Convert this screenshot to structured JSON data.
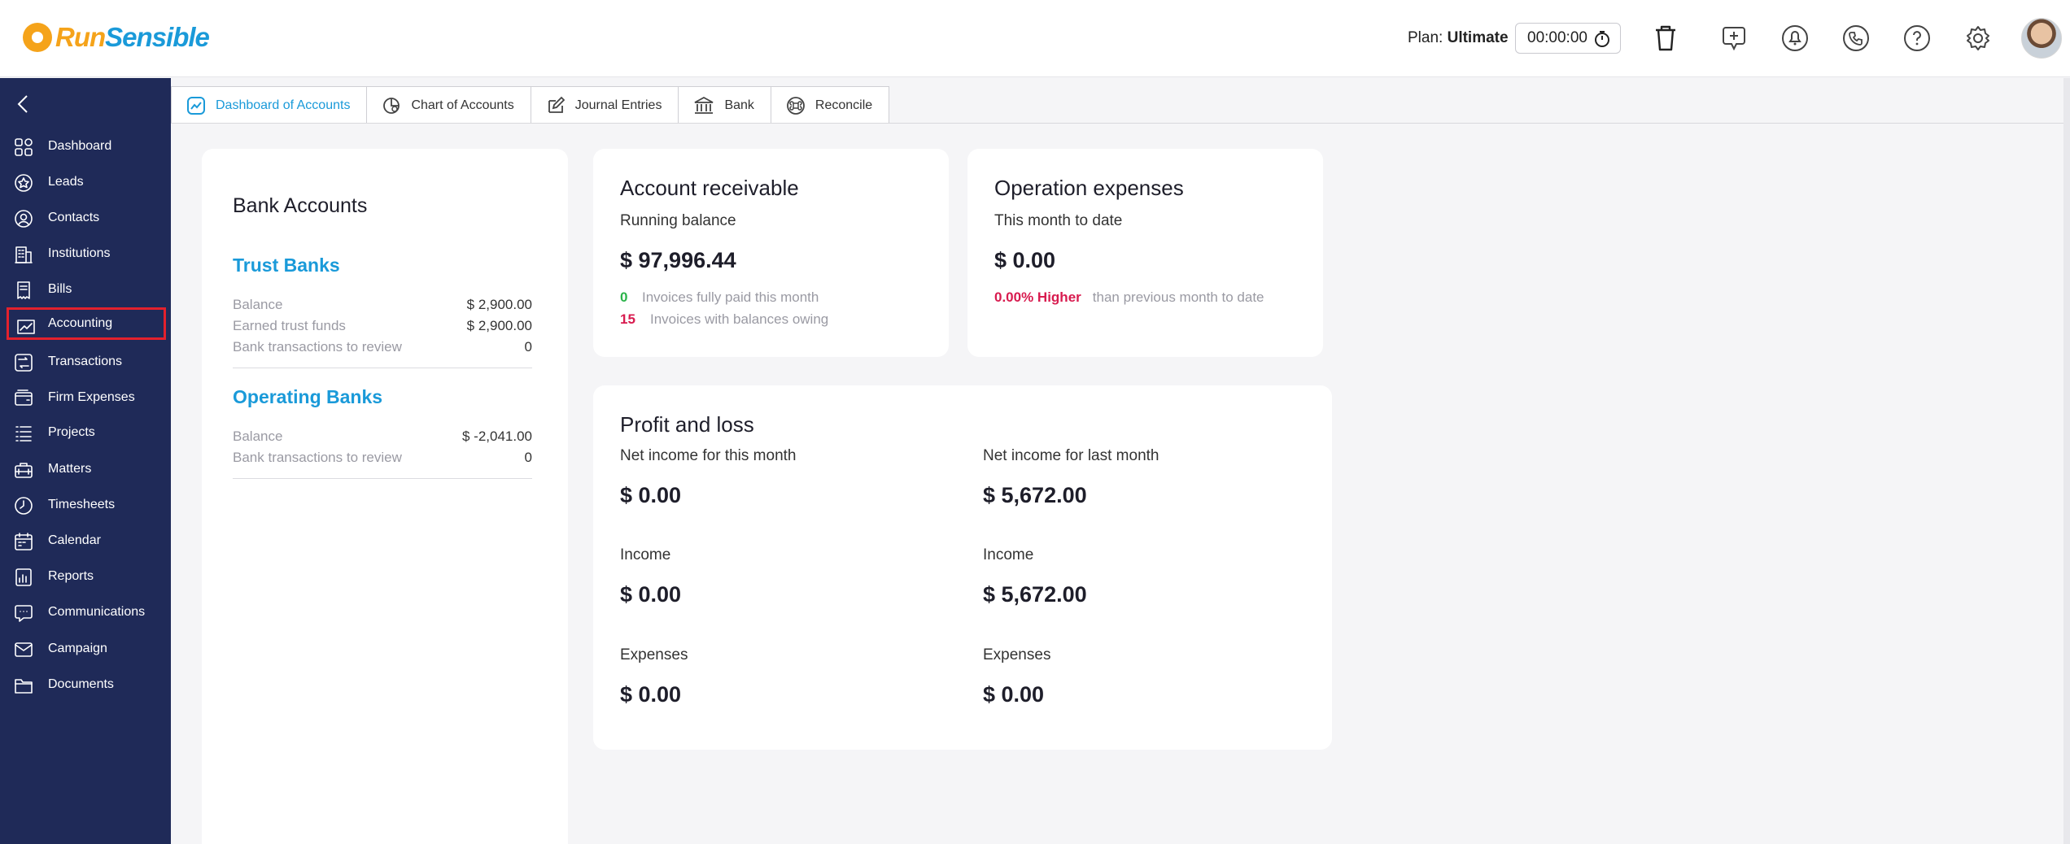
{
  "app": {
    "logo_part1": "Run",
    "logo_part2": "Sensible"
  },
  "header": {
    "plan_label": "Plan:",
    "plan_value": "Ultimate",
    "timer": "00:00:00",
    "icons": [
      "trash-icon",
      "add-icon",
      "bell-icon",
      "phone-icon",
      "help-icon",
      "gear-icon"
    ]
  },
  "sidebar": {
    "items": [
      {
        "label": "Dashboard",
        "icon": "dashboard-icon"
      },
      {
        "label": "Leads",
        "icon": "star-icon"
      },
      {
        "label": "Contacts",
        "icon": "contact-icon"
      },
      {
        "label": "Institutions",
        "icon": "building-icon"
      },
      {
        "label": "Bills",
        "icon": "bill-icon"
      },
      {
        "label": "Accounting",
        "icon": "accounting-icon",
        "active": true
      },
      {
        "label": "Transactions",
        "icon": "transactions-icon"
      },
      {
        "label": "Firm Expenses",
        "icon": "wallet-icon"
      },
      {
        "label": "Projects",
        "icon": "list-icon"
      },
      {
        "label": "Matters",
        "icon": "briefcase-icon"
      },
      {
        "label": "Timesheets",
        "icon": "clock-icon"
      },
      {
        "label": "Calendar",
        "icon": "calendar-icon"
      },
      {
        "label": "Reports",
        "icon": "reports-icon"
      },
      {
        "label": "Communications",
        "icon": "chat-icon"
      },
      {
        "label": "Campaign",
        "icon": "mail-icon"
      },
      {
        "label": "Documents",
        "icon": "folder-icon"
      }
    ]
  },
  "tabs": [
    {
      "label": "Dashboard of Accounts",
      "icon": "chart-line-icon",
      "active": true
    },
    {
      "label": "Chart of Accounts",
      "icon": "pie-chart-icon"
    },
    {
      "label": "Journal Entries",
      "icon": "edit-icon"
    },
    {
      "label": "Bank",
      "icon": "bank-icon"
    },
    {
      "label": "Reconcile",
      "icon": "reconcile-icon"
    }
  ],
  "bank_accounts": {
    "title": "Bank Accounts",
    "trust": {
      "heading": "Trust Banks",
      "rows": [
        {
          "label": "Balance",
          "value": "$ 2,900.00"
        },
        {
          "label": "Earned trust funds",
          "value": "$ 2,900.00"
        },
        {
          "label": "Bank transactions to review",
          "value": "0"
        }
      ]
    },
    "operating": {
      "heading": "Operating Banks",
      "rows": [
        {
          "label": "Balance",
          "value": "$ -2,041.00"
        },
        {
          "label": "Bank transactions to review",
          "value": "0"
        }
      ]
    }
  },
  "receivable": {
    "title": "Account receivable",
    "subtitle": "Running balance",
    "amount": "$ 97,996.44",
    "paid_count": "0",
    "paid_text": "Invoices fully paid this month",
    "owing_count": "15",
    "owing_text": "Invoices with balances owing",
    "colors": {
      "paid": "#2bb34a",
      "owing": "#d81b4f"
    }
  },
  "expenses": {
    "title": "Operation expenses",
    "subtitle": "This month to date",
    "amount": "$ 0.00",
    "change": "0.00% Higher",
    "change_text": "than previous month to date"
  },
  "pnl": {
    "title": "Profit and loss",
    "this_month": {
      "net_label": "Net income for this month",
      "net_value": "$ 0.00",
      "income_label": "Income",
      "income_value": "$ 0.00",
      "expenses_label": "Expenses",
      "expenses_value": "$ 0.00"
    },
    "last_month": {
      "net_label": "Net income for last month",
      "net_value": "$ 5,672.00",
      "income_label": "Income",
      "income_value": "$ 5,672.00",
      "expenses_label": "Expenses",
      "expenses_value": "$ 0.00"
    }
  },
  "theme": {
    "sidebar_bg": "#1f2a58",
    "accent": "#1a9ad9",
    "brand_orange": "#f5a31a",
    "highlight": "#e3212d"
  }
}
